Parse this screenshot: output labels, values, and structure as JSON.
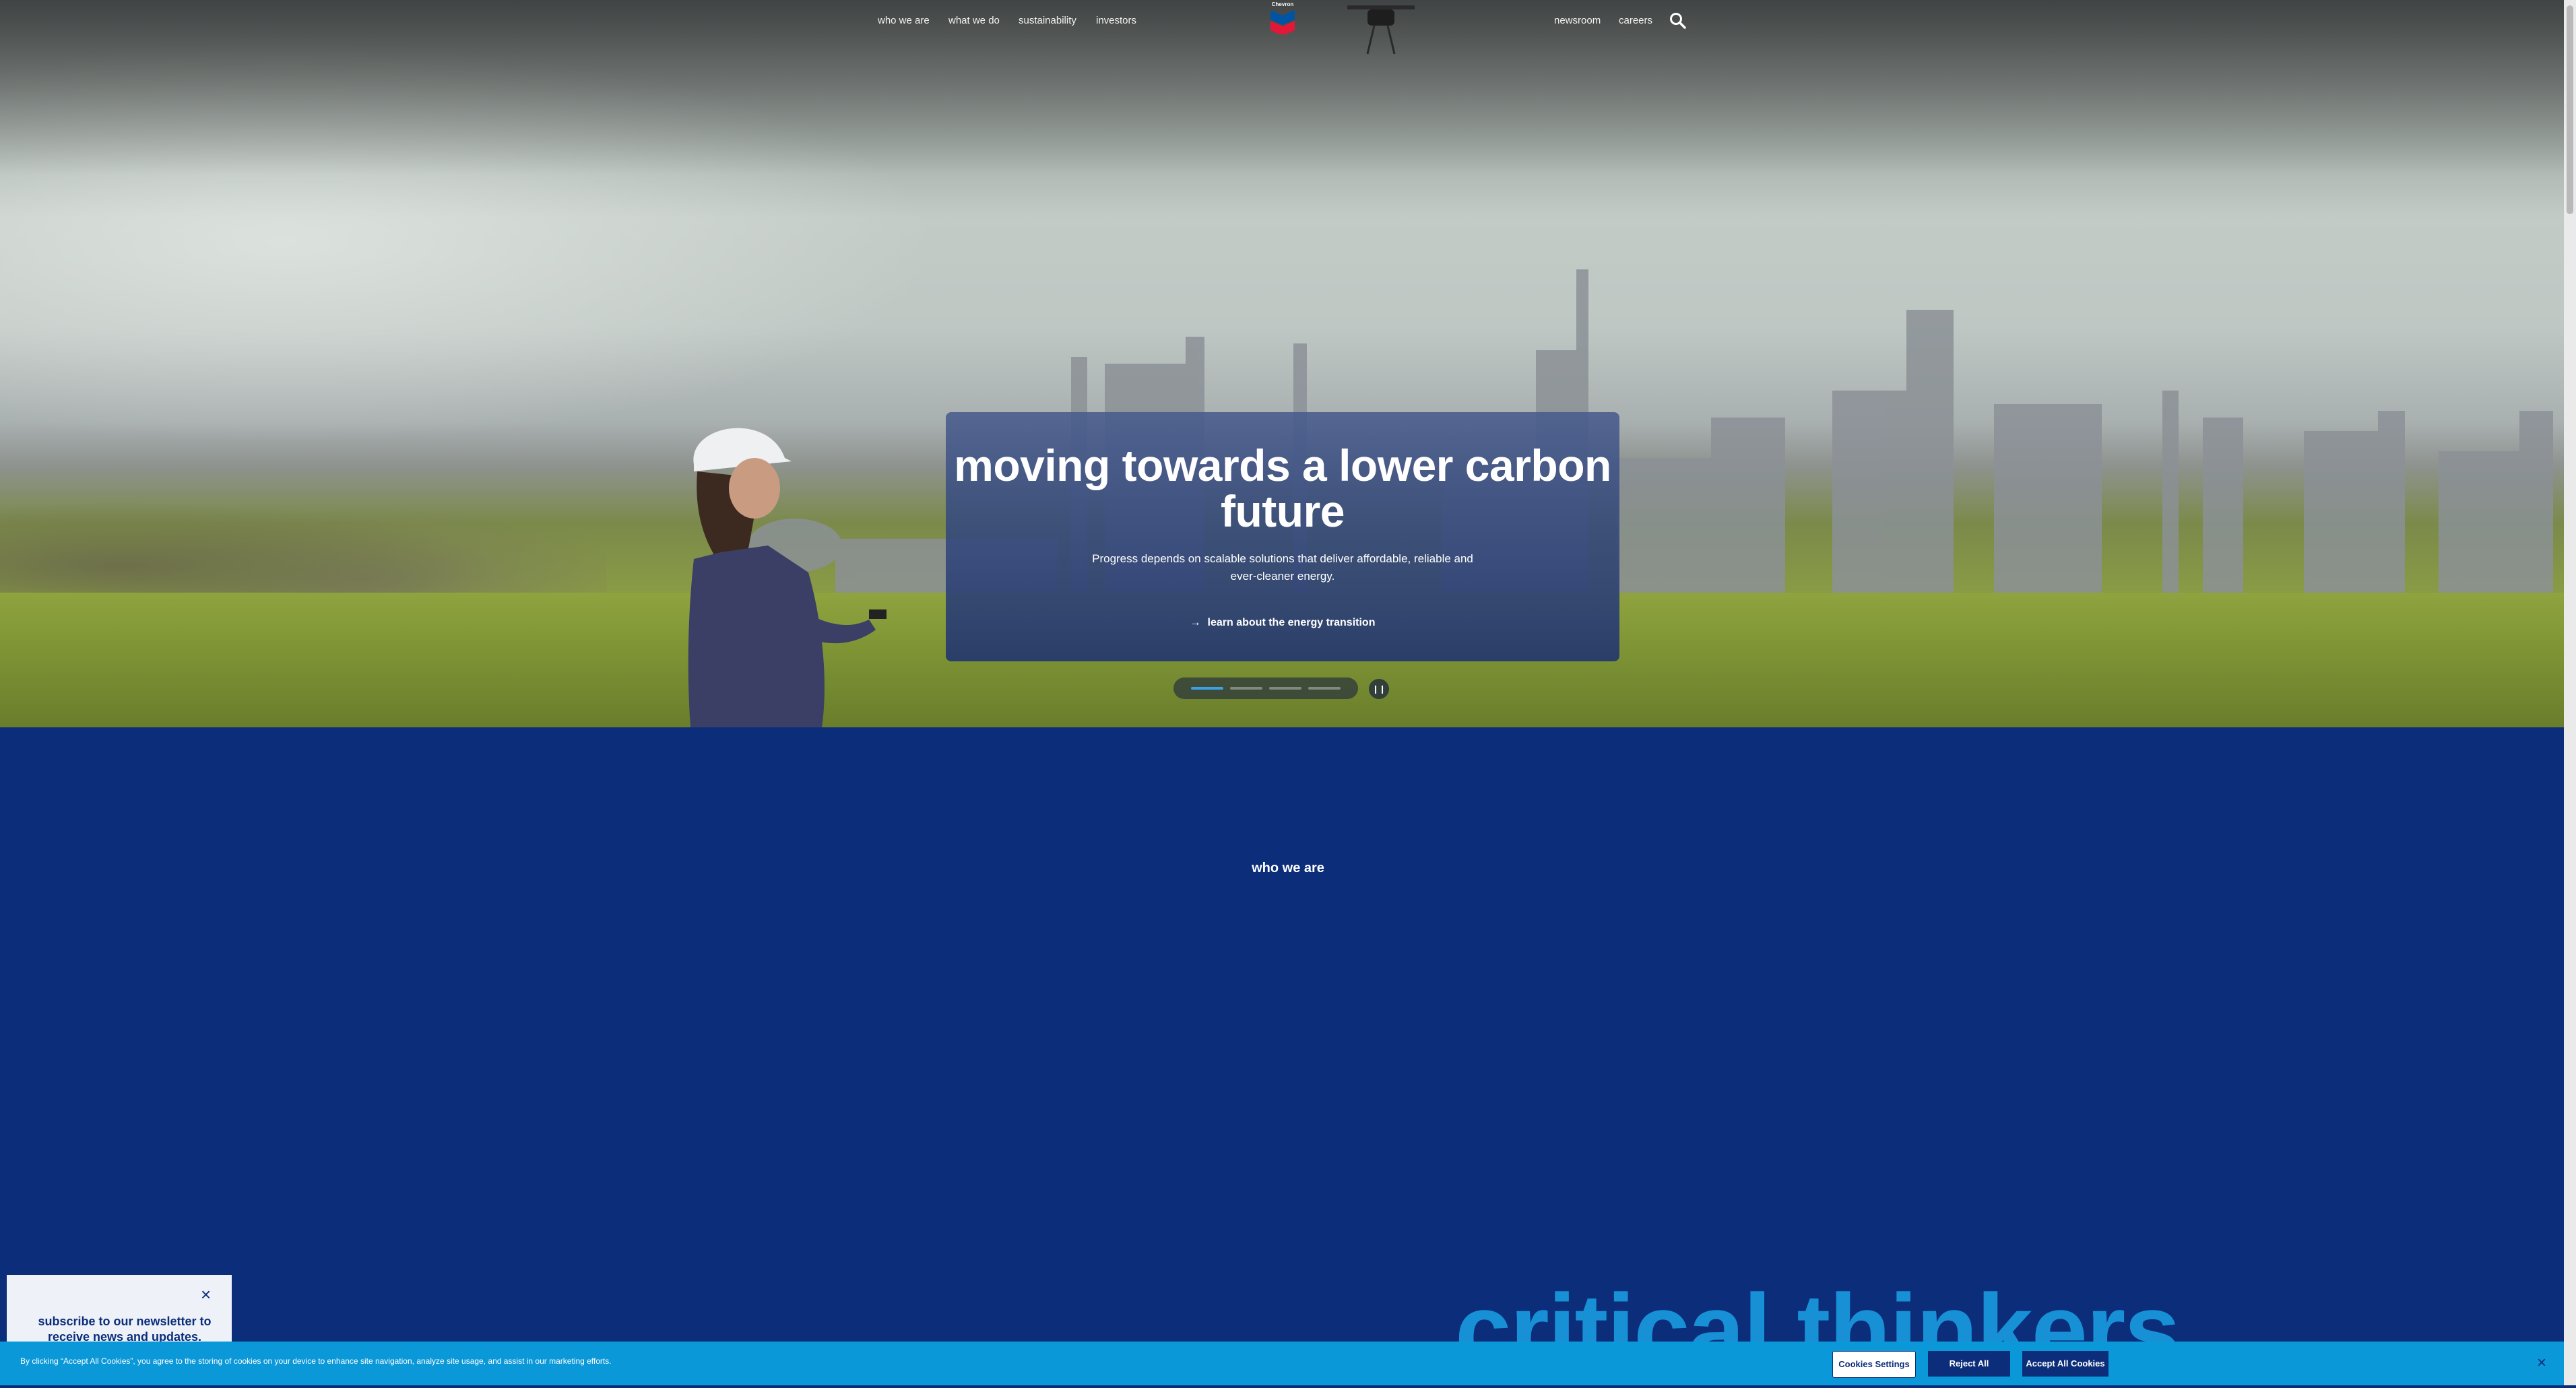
{
  "nav": {
    "left_items": [
      "who we are",
      "what we do",
      "sustainability",
      "investors"
    ],
    "right_items": [
      "newsroom",
      "careers"
    ],
    "logo_text": "Chevron",
    "search_icon": "search-icon"
  },
  "hero": {
    "title": "moving towards a lower carbon future",
    "description": "Progress depends on scalable solutions that deliver affordable, reliable and ever-cleaner energy.",
    "cta_label": "learn about the energy transition",
    "carousel_slides": 4,
    "carousel_active": 1,
    "pause_icon": "pause-icon"
  },
  "who": {
    "section_label": "who we are",
    "big_word": "critical thinkers"
  },
  "newsletter": {
    "text": "subscribe to our newsletter to receive news and updates.",
    "close_icon": "close-icon"
  },
  "cookie": {
    "message": "By clicking “Accept All Cookies”, you agree to the storing of cookies on your device to enhance site navigation, analyze site usage, and assist in our marketing efforts.",
    "settings_label": "Cookies Settings",
    "reject_label": "Reject All",
    "accept_label": "Accept All Cookies",
    "close_icon": "close-icon"
  },
  "colors": {
    "primary_blue": "#0b2d7a",
    "cookie_blue": "#0b98d8",
    "accent_blue": "#1890d6"
  }
}
